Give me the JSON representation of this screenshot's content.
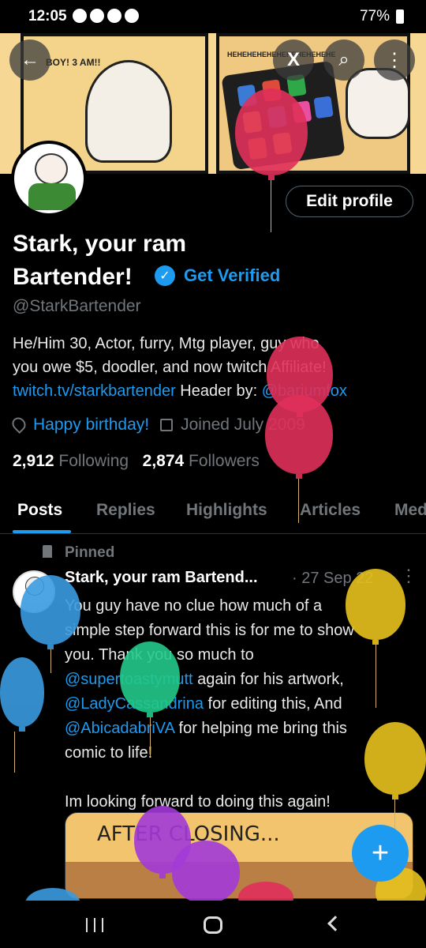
{
  "status_bar": {
    "time": "12:05",
    "battery": "77%"
  },
  "header": {
    "panel_left_text": "BOY! 3 AM!!",
    "panel_right_text": "HEHEHEHEHEHEHEHEHEHEHE",
    "buttons": {
      "back": "←",
      "grok": "X",
      "search": "⌕",
      "more": "⋮"
    }
  },
  "profile": {
    "edit_profile_label": "Edit profile",
    "name_line1": "Stark, your ram",
    "name_line2": "Bartender!",
    "get_verified_label": "Get Verified",
    "handle": "@StarkBartender",
    "bio_line1": "He/Him 30, Actor, furry, Mtg player, guy who",
    "bio_line2": "you owe $5, doodler, and now twitch Affiliate!",
    "bio_link": "twitch.tv/starkbartender",
    "bio_header_by": " Header by: ",
    "bio_mention": "@bariumfox",
    "birthday": "Happy birthday!",
    "joined": "Joined July 2009",
    "following_count": "2,912",
    "following_label": "Following",
    "followers_count": "2,874",
    "followers_label": "Followers"
  },
  "tabs": [
    {
      "label": "Posts",
      "active": true
    },
    {
      "label": "Replies"
    },
    {
      "label": "Highlights"
    },
    {
      "label": "Articles"
    },
    {
      "label": "Media"
    }
  ],
  "pinned_post": {
    "pinned_label": "Pinned",
    "author": "Stark, your ram Bartend...",
    "date": "· 27 Sep 22",
    "more": "⋮",
    "line1": "You guy have no clue how much of a",
    "line2": "simple step forward this is for me to show",
    "line3": "you. Thank you so much to",
    "mention1": "@supertoastymutt",
    "line4_rest": " again for his artwork,",
    "mention2": "@LadyCassandrina",
    "line5_rest": " for editing this, And",
    "mention3": "@AbicadabriVA",
    "line6_rest": " for helping me bring this",
    "line7": "comic to life!",
    "line8": "Im looking forward to doing this again!",
    "media_text": "AFTER CLOSING..."
  },
  "fab_label": "+",
  "colors": {
    "accent": "#1d9bf0",
    "background": "#000000",
    "muted": "#71767b"
  },
  "icons": [
    "back-arrow-icon",
    "grok-icon",
    "search-icon",
    "more-icon",
    "verified-icon",
    "location-icon",
    "calendar-icon",
    "pin-icon",
    "plus-icon",
    "balloon-icon"
  ]
}
